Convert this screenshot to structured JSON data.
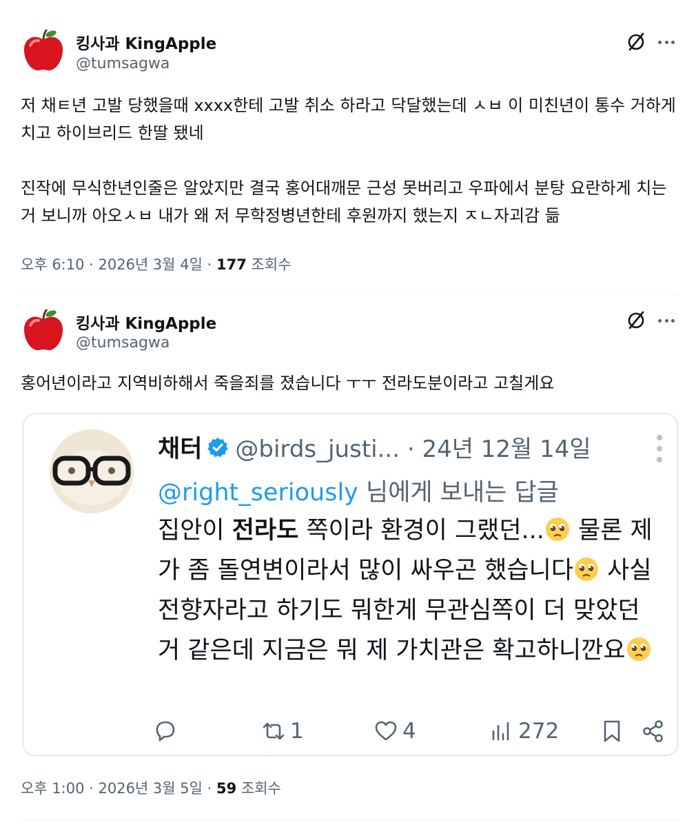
{
  "post1": {
    "display_name": "킹사과 KingApple",
    "handle": "@tumsagwa",
    "text": "저 채ㅌ년 고발 당했을때 xxxx한테 고발 취소 하라고 닥달했는데 ㅅㅂ 이 미친년이 통수 거하게 치고 하이브리드 한딸 됐네\n\n진작에 무식한년인줄은 알았지만 결국 홍어대깨문 근성 못버리고 우파에서 분탕 요란하게 치는거 보니까 아오ㅅㅂ 내가 왜 저 무학정병년한테 후원까지 했는지 ㅈㄴ자괴감 듦",
    "time": "오후 6:10 · 2026년 3월 4일 ·",
    "views": "177",
    "views_label": "조회수"
  },
  "post2": {
    "display_name": "킹사과 KingApple",
    "handle": "@tumsagwa",
    "text": "홍어년이라고 지역비하해서 죽을죄를 졌습니다 ㅜㅜ 전라도분이라고 고칠게요",
    "time": "오후 1:00 · 2026년 3월 5일 ·",
    "views": "59",
    "views_label": "조회수"
  },
  "quote": {
    "display_name": "채터",
    "handle_date": "@birds_justi... · 24년 12월 14일",
    "reply_mention": "@right_seriously",
    "reply_suffix": " 님에게 보내는 답글",
    "text_part1": "집안이 ",
    "text_bold": "전라도",
    "text_part2": " 쪽이라 환경이 그랬던...",
    "text_part3": " 물론 제가 좀 돌연변이라서 많이 싸우곤 했습니다",
    "text_part4": " 사실 전향자라고 하기도 뭐한게 무관심쪽이 더 맞았던 거 같은데 지금은 뭐 제 가치관은 확고하니깐요",
    "retweets": "1",
    "likes": "4",
    "views": "272"
  },
  "icons": {
    "grok": "grok-icon",
    "more": "more-icon",
    "verified": "verified-badge-icon",
    "emoji": "pleading-face-emoji",
    "reply": "reply-icon",
    "retweet": "retweet-icon",
    "like": "heart-icon",
    "views": "views-icon",
    "bookmark": "bookmark-icon",
    "share": "share-icon"
  },
  "colors": {
    "accent": "#1d9bf0",
    "text": "#0f1419",
    "secondary": "#536471",
    "border": "#cfd9de"
  }
}
